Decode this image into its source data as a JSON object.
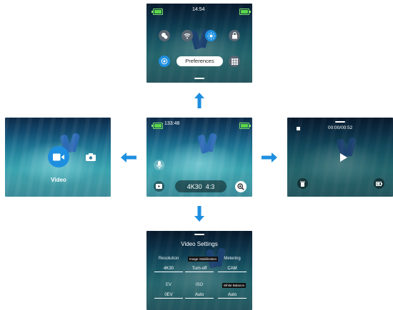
{
  "top_screen": {
    "time": "14:54",
    "preferences_label": "Preferences",
    "icons": [
      "bubble-icon",
      "wifi-icon",
      "brightness-icon",
      "lock-icon",
      "gps-icon",
      "grid-icon"
    ],
    "colors": {
      "accent": "#1e8fe0"
    }
  },
  "center_screen": {
    "remaining": "133:48",
    "resolution": "4K30",
    "ratio": "4:3"
  },
  "left_screen": {
    "mode_label": "Video"
  },
  "right_screen": {
    "timecode": "00:00/00:52"
  },
  "bottom_screen": {
    "title": "Video Settings",
    "settings": [
      {
        "label": "Resolution",
        "value": "4K30"
      },
      {
        "label": "Image Stabilization",
        "value": "Turn-off"
      },
      {
        "label": "Metering",
        "value": "CAM"
      },
      {
        "label": "EV",
        "value": "0EV"
      },
      {
        "label": "ISO",
        "value": "Auto"
      },
      {
        "label": "White Balance",
        "value": "Auto"
      }
    ]
  },
  "arrow_color": "#1e8fe0"
}
